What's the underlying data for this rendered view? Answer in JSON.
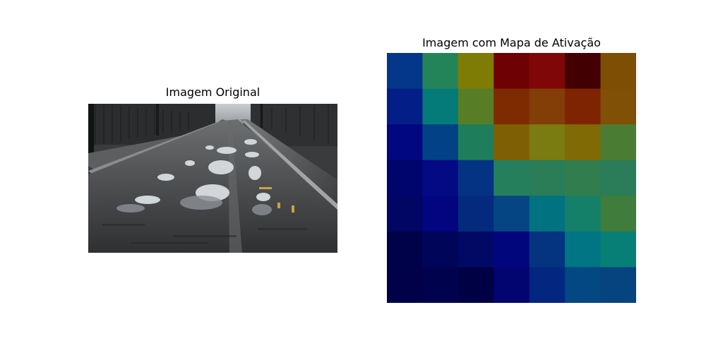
{
  "figure": {
    "left_title": "Imagem Original",
    "right_title": "Imagem com Mapa de Ativação"
  },
  "activation_map": {
    "rows": 7,
    "cols": 7,
    "colors": [
      [
        "#04378a",
        "#248459",
        "#7f7c05",
        "#6e0104",
        "#800707",
        "#420002",
        "#7e4e05"
      ],
      [
        "#031e86",
        "#047a79",
        "#577e27",
        "#7f2b02",
        "#833d07",
        "#7f2403",
        "#7f5006"
      ],
      [
        "#010780",
        "#024186",
        "#1e7e5c",
        "#7f5f03",
        "#7a7b10",
        "#7f6a05",
        "#4b7c33"
      ],
      [
        "#00056d",
        "#030a83",
        "#043383",
        "#267f5c",
        "#2a7d57",
        "#327d4e",
        "#2a7d58"
      ],
      [
        "#010564",
        "#02057f",
        "#032a7d",
        "#054583",
        "#017280",
        "#158069",
        "#407c3c"
      ],
      [
        "#000249",
        "#00055a",
        "#010965",
        "#02067d",
        "#04347f",
        "#017583",
        "#077f77"
      ],
      [
        "#000148",
        "#00024d",
        "#000044",
        "#020570",
        "#032680",
        "#034783",
        "#05447f"
      ]
    ]
  }
}
